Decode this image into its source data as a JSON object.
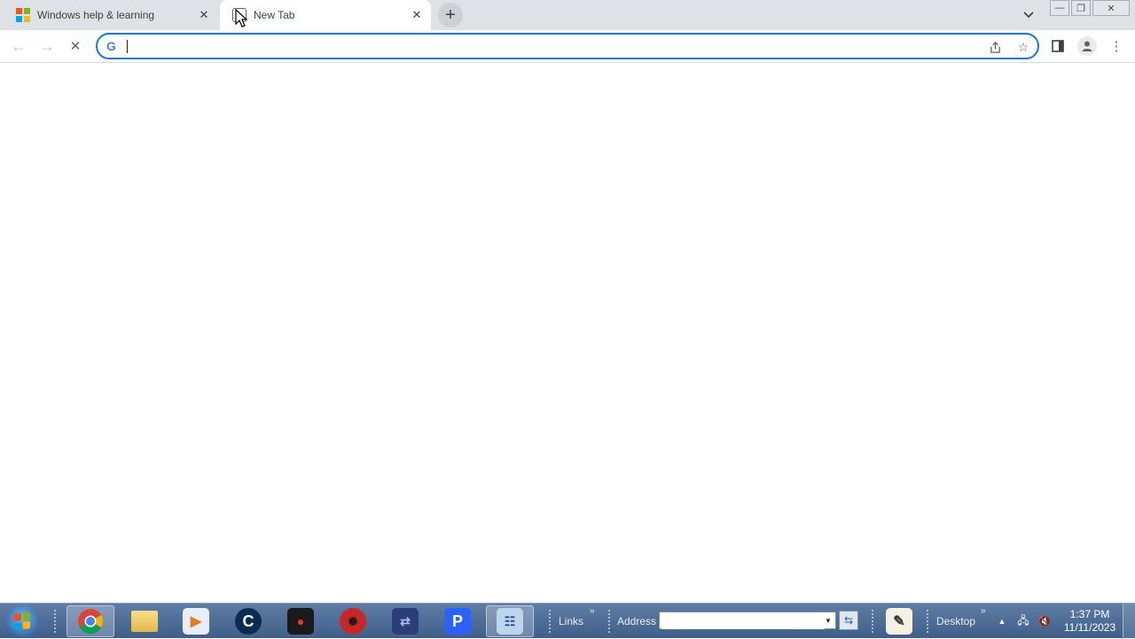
{
  "browser": {
    "tabs": [
      {
        "title": "Windows help & learning",
        "active": false,
        "favicon": "microsoft-logo-icon"
      },
      {
        "title": "New Tab",
        "active": true,
        "favicon": "new-tab-icon"
      }
    ],
    "omnibox": {
      "value": "",
      "placeholder": ""
    },
    "colors": {
      "accent": "#1a73e8",
      "tabstrip": "#dee1e6"
    }
  },
  "taskbar": {
    "apps": [
      {
        "name": "Google Chrome",
        "icon": "chrome-icon"
      },
      {
        "name": "File Explorer",
        "icon": "folder-icon"
      },
      {
        "name": "Media Player",
        "icon": "media-player-icon"
      },
      {
        "name": "CCleaner",
        "icon": "ccleaner-icon"
      },
      {
        "name": "Screen Recorder",
        "icon": "screen-recorder-icon"
      },
      {
        "name": "Security App",
        "icon": "security-app-icon"
      },
      {
        "name": "Remote App",
        "icon": "remote-app-icon"
      },
      {
        "name": "P App",
        "icon": "p-app-icon"
      },
      {
        "name": "Control Panel",
        "icon": "control-panel-icon"
      }
    ],
    "links_label": "Links",
    "address_label": "Address",
    "address_value": "",
    "desktop_label": "Desktop",
    "clock": {
      "time": "1:37 PM",
      "date": "11/11/2023"
    }
  }
}
